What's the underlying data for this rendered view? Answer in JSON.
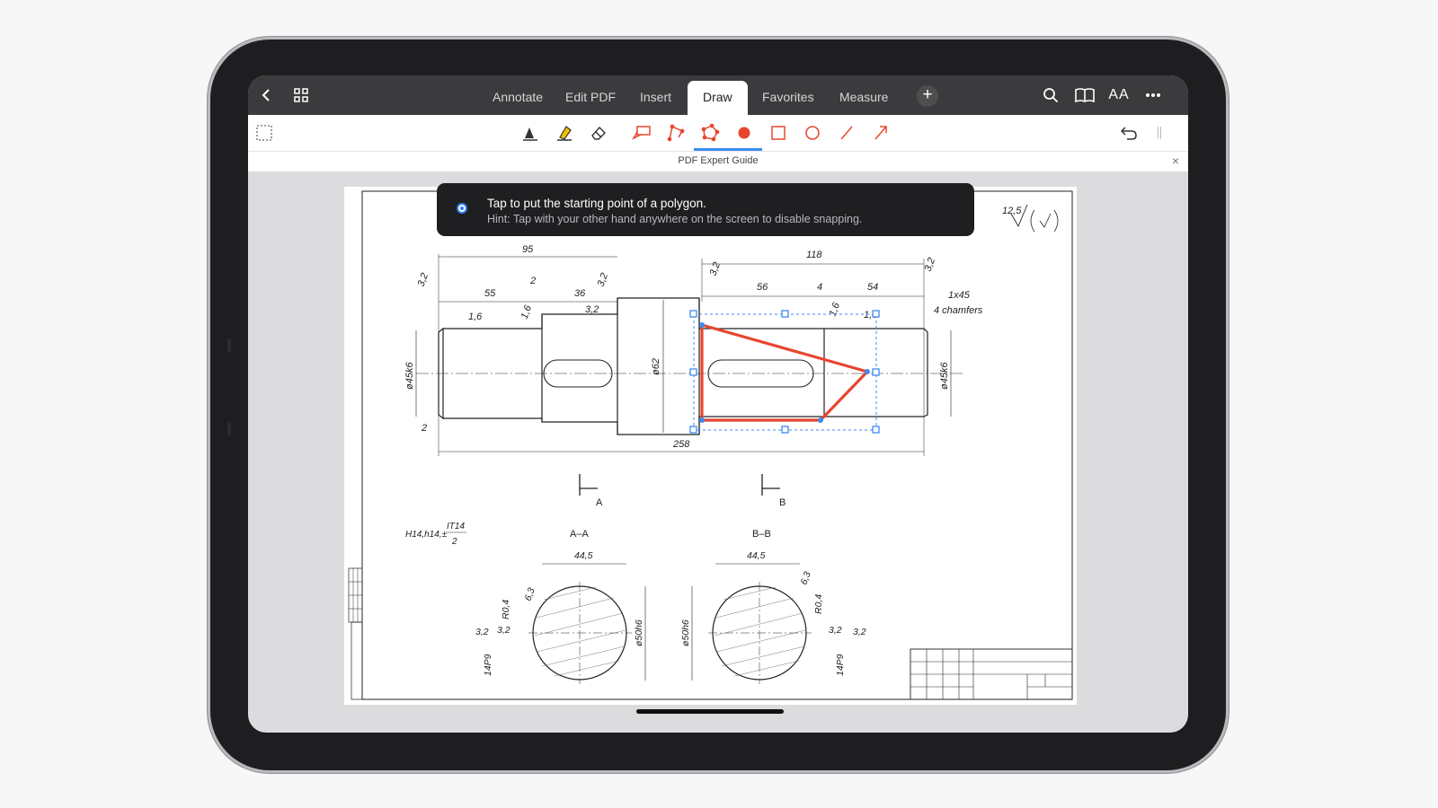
{
  "topbar": {
    "back_icon": "chevron-left-icon",
    "grid_icon": "grid-icon",
    "tabs": [
      {
        "label": "Annotate"
      },
      {
        "label": "Edit PDF"
      },
      {
        "label": "Insert"
      },
      {
        "label": "Draw",
        "active": true
      },
      {
        "label": "Favorites"
      },
      {
        "label": "Measure"
      }
    ],
    "add_label": "+",
    "right_icons": [
      "search-icon",
      "book-icon",
      "font-size-icon",
      "more-icon"
    ],
    "font_size_label": "AA"
  },
  "toolbar": {
    "tools": [
      "pen",
      "highlighter",
      "eraser",
      "callout",
      "polyline",
      "polygon",
      "color-dot",
      "rectangle",
      "ellipse",
      "line",
      "arrow"
    ],
    "selected_tool": "polygon",
    "accent_color": "#e8452f"
  },
  "guide": {
    "title": "PDF Expert Guide",
    "close_label": "×"
  },
  "hint": {
    "title": "Tap to put the starting point of a polygon.",
    "subtitle": "Hint: Tap with your other hand anywhere on the screen to disable snapping."
  },
  "drawing": {
    "roughness": "12,5",
    "dims": {
      "d95": "95",
      "d118": "118",
      "d55": "55",
      "d2a": "2",
      "d36": "36",
      "d32a": "3,2",
      "d32b": "3,2",
      "d32c": "3,2",
      "d32d": "3,2",
      "d16a": "1,6",
      "d16b": "1,6",
      "d16c": "1,6",
      "d16d": "1,6",
      "d56": "56",
      "d4": "4",
      "d54": "54",
      "chamfer1": "1x45",
      "chamfer2": "4 chamfers",
      "d45a": "ø45k6",
      "d62": "ø62",
      "d45b": "ø45k6",
      "d2b": "2",
      "d258": "258",
      "secA": "A",
      "secB": "B",
      "tolerance": "H14,h14,±",
      "tol_num": "IT14",
      "tol_den": "2",
      "secAA": "A–A",
      "secBB": "B–B",
      "d445a": "44,5",
      "d445b": "44,5",
      "d63a": "6,3",
      "d63b": "6,3",
      "r04a": "R0,4",
      "r04b": "R0,4",
      "d32e": "3,2",
      "d32f": "3,2",
      "d32g": "3,2",
      "d32h": "3,2",
      "d50a": "ø50h6",
      "d50b": "ø50h6",
      "p14a": "14P9",
      "p14b": "14P9"
    }
  },
  "annotation": {
    "shape": "polygon",
    "stroke_color": "#e8452f",
    "selection_color": "#3c8bf0"
  }
}
